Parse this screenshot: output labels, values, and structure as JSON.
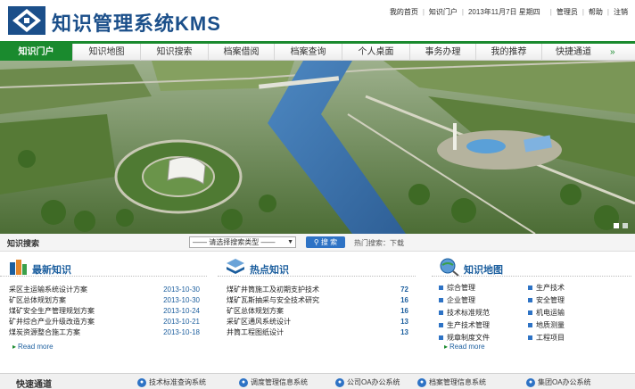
{
  "header": {
    "title": "知识管理系统KMS",
    "top_links": [
      "我的首页",
      "知识门户"
    ],
    "date": "2013年11月7日 星期四",
    "user_links": [
      "管理员",
      "帮助",
      "注销"
    ]
  },
  "nav": {
    "items": [
      "知识门户",
      "知识地图",
      "知识搜索",
      "档案借阅",
      "档案查询",
      "个人桌面",
      "事务办理",
      "我的推荐",
      "快捷通道"
    ],
    "active": "知识门户",
    "more": "»"
  },
  "search": {
    "label": "知识搜索",
    "select_value": "—— 请选择搜索类型 ——",
    "button": "搜 索",
    "hot_words": "热门搜索：下载"
  },
  "latest": {
    "title": "最新知识",
    "rows": [
      {
        "text": "采区主运输系统设计方案",
        "date": "2013-10-30"
      },
      {
        "text": "矿区总体规划方案",
        "date": "2013-10-30"
      },
      {
        "text": "煤矿安全生产管理规划方案",
        "date": "2013-10-24"
      },
      {
        "text": "矿井综合产业升级改造方案",
        "date": "2013-10-21"
      },
      {
        "text": "煤炭资源整合施工方案",
        "date": "2013-10-18"
      }
    ],
    "read_more": "Read more"
  },
  "hot": {
    "title": "热点知识",
    "rows": [
      {
        "text": "煤矿井筒施工及初期支护技术",
        "count": "72"
      },
      {
        "text": "煤矿瓦斯抽采与安全技术研究",
        "count": "16"
      },
      {
        "text": "矿区总体规划方案",
        "count": "16"
      },
      {
        "text": "采矿区通风系统设计",
        "count": "13"
      },
      {
        "text": "井筒工程图纸设计",
        "count": "13"
      }
    ]
  },
  "map": {
    "title": "知识地图",
    "cells": [
      "综合管理",
      "生产技术",
      "企业管理",
      "安全管理",
      "技术标准规范",
      "机电运输",
      "生产技术管理",
      "地质测量",
      "规章制度文件",
      "工程项目"
    ],
    "read_more": "Read more"
  },
  "quick": {
    "title": "快速通道",
    "items": [
      "技术标准查询系统",
      "调度管理信息系统",
      "公司OA办公系统",
      "档案管理信息系统",
      "集团OA办公系统"
    ]
  }
}
